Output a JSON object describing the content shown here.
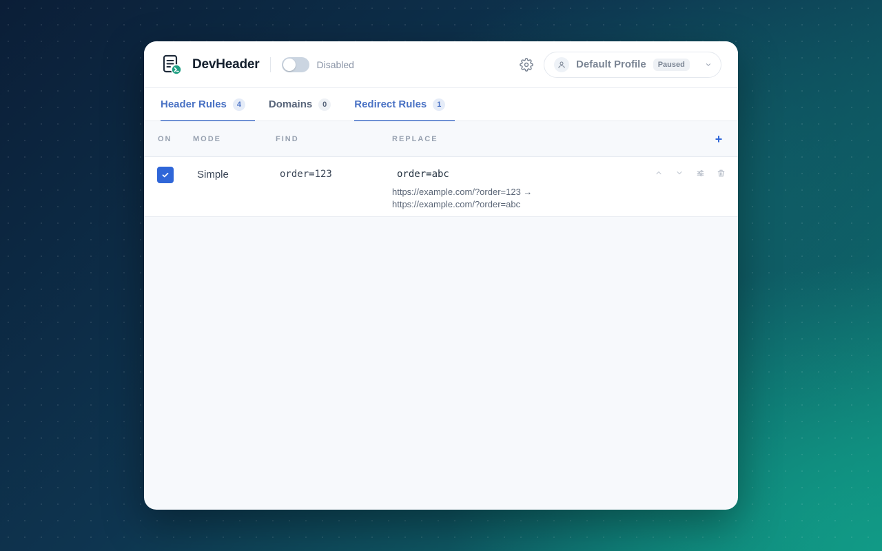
{
  "app": {
    "name": "DevHeader"
  },
  "toggle": {
    "label": "Disabled"
  },
  "profile": {
    "name": "Default Profile",
    "status": "Paused"
  },
  "tabs": [
    {
      "label": "Header Rules",
      "count": "4"
    },
    {
      "label": "Domains",
      "count": "0"
    },
    {
      "label": "Redirect Rules",
      "count": "1"
    }
  ],
  "table": {
    "headers": {
      "on": "ON",
      "mode": "MODE",
      "find": "FIND",
      "replace": "REPLACE"
    },
    "add_label": "+",
    "rows": [
      {
        "enabled": true,
        "mode": "Simple",
        "find": "order=123",
        "replace": "order=abc",
        "preview_line1": "https://example.com/?order=123 →",
        "preview_line2": "https://example.com/?order=abc"
      }
    ]
  },
  "colors": {
    "accent": "#2f66d8",
    "active_tab": "#4a72c4",
    "logo_badge": "#1f9e82"
  },
  "icons": [
    "document-terminal-icon",
    "gear-icon",
    "user-icon",
    "chevron-down-icon",
    "check-icon",
    "arrow-up-icon",
    "arrow-down-icon",
    "sliders-icon",
    "trash-icon"
  ]
}
